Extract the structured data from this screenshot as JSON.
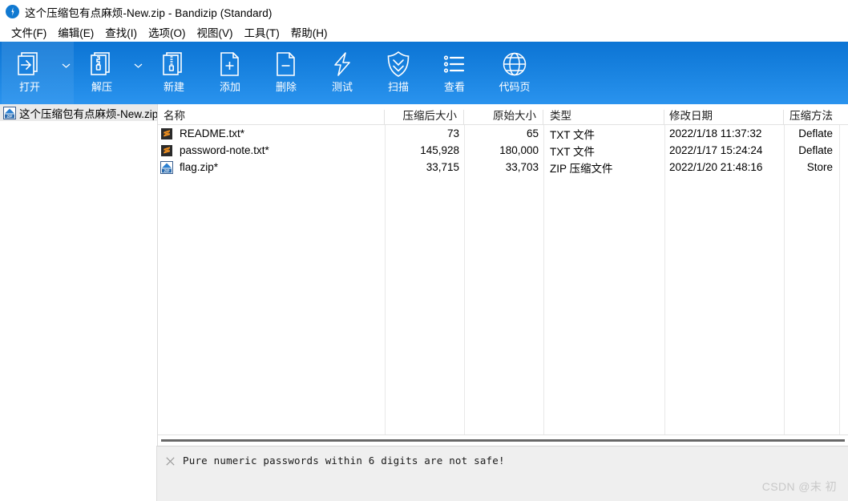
{
  "window": {
    "title": "这个压缩包有点麻烦-New.zip - Bandizip (Standard)",
    "app_icon": "bandizip-bolt-icon"
  },
  "menubar": {
    "items": [
      {
        "label": "文件(F)",
        "name": "menu-file"
      },
      {
        "label": "编辑(E)",
        "name": "menu-edit"
      },
      {
        "label": "查找(I)",
        "name": "menu-find"
      },
      {
        "label": "选项(O)",
        "name": "menu-options"
      },
      {
        "label": "视图(V)",
        "name": "menu-view"
      },
      {
        "label": "工具(T)",
        "name": "menu-tools"
      },
      {
        "label": "帮助(H)",
        "name": "menu-help"
      }
    ]
  },
  "toolbar": {
    "buttons": [
      {
        "label": "打开",
        "icon": "open-archive-icon",
        "has_dropdown": true,
        "highlighted": true
      },
      {
        "label": "解压",
        "icon": "extract-icon",
        "has_dropdown": true,
        "highlighted": false
      },
      {
        "label": "新建",
        "icon": "new-archive-icon",
        "has_dropdown": false,
        "highlighted": false
      },
      {
        "label": "添加",
        "icon": "add-file-icon",
        "has_dropdown": false,
        "highlighted": false
      },
      {
        "label": "删除",
        "icon": "delete-file-icon",
        "has_dropdown": false,
        "highlighted": false
      },
      {
        "label": "测试",
        "icon": "test-bolt-icon",
        "has_dropdown": false,
        "highlighted": false
      },
      {
        "label": "扫描",
        "icon": "scan-shield-icon",
        "has_dropdown": false,
        "highlighted": false
      },
      {
        "label": "查看",
        "icon": "view-list-icon",
        "has_dropdown": false,
        "highlighted": false
      },
      {
        "label": "代码页",
        "icon": "codepage-globe-icon",
        "has_dropdown": false,
        "highlighted": false
      }
    ]
  },
  "sidebar": {
    "root": {
      "label": "这个压缩包有点麻烦-New.zip",
      "icon": "zip-archive-icon",
      "selected": true
    }
  },
  "filelist": {
    "columns": [
      {
        "key": "name",
        "label": "名称"
      },
      {
        "key": "packed",
        "label": "压缩后大小"
      },
      {
        "key": "orig",
        "label": "原始大小"
      },
      {
        "key": "type",
        "label": "类型"
      },
      {
        "key": "date",
        "label": "修改日期"
      },
      {
        "key": "method",
        "label": "压缩方法"
      }
    ],
    "sort_indicator": "chevron-down-icon",
    "rows": [
      {
        "icon": "sublime-text-file-icon",
        "name": "README.txt*",
        "packed": "73",
        "orig": "65",
        "type": "TXT 文件",
        "date": "2022/1/18 11:37:32",
        "method": "Deflate"
      },
      {
        "icon": "sublime-text-file-icon",
        "name": "password-note.txt*",
        "packed": "145,928",
        "orig": "180,000",
        "type": "TXT 文件",
        "date": "2022/1/17 15:24:24",
        "method": "Deflate"
      },
      {
        "icon": "zip-archive-icon",
        "name": "flag.zip*",
        "packed": "33,715",
        "orig": "33,703",
        "type": "ZIP 压缩文件",
        "date": "2022/1/20 21:48:16",
        "method": "Store"
      }
    ]
  },
  "comment_panel": {
    "close_icon": "close-x-icon",
    "text": "Pure numeric passwords within 6 digits are not safe!"
  },
  "watermark": {
    "text": "CSDN @末 初"
  },
  "colors": {
    "toolbar_top": "#0c74d4",
    "toolbar_bottom": "#2a93ee",
    "selection": "#eaeaea",
    "panel_bg": "#efefef",
    "text": "#000000"
  }
}
